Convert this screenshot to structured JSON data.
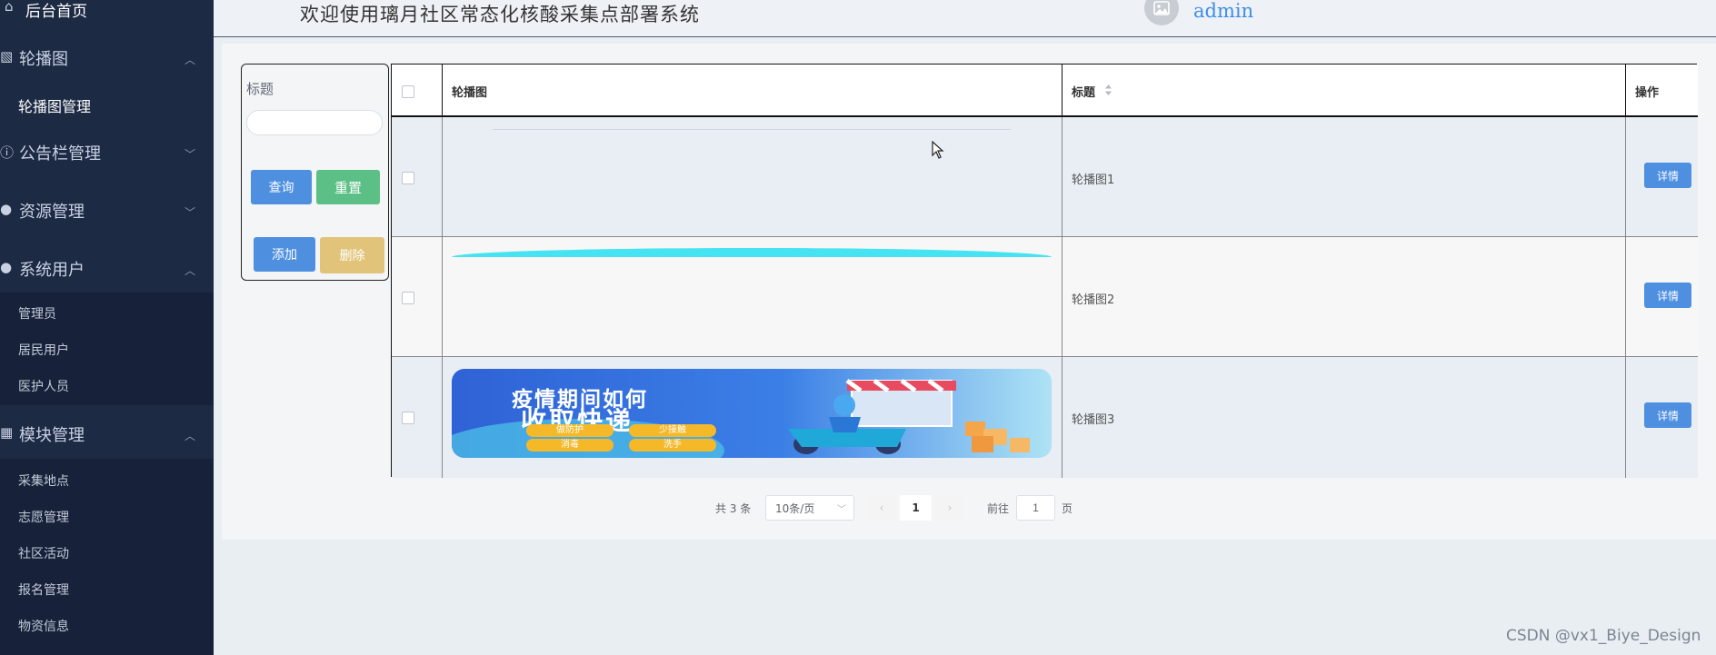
{
  "sidebar": {
    "home": "后台首页",
    "carousel": {
      "label": "轮播图",
      "items": [
        "轮播图管理"
      ]
    },
    "notice": {
      "label": "公告栏管理"
    },
    "resource": {
      "label": "资源管理"
    },
    "system_users": {
      "label": "系统用户",
      "items": [
        "管理员",
        "居民用户",
        "医护人员"
      ]
    },
    "modules": {
      "label": "模块管理",
      "items": [
        "采集地点",
        "志愿管理",
        "社区活动",
        "报名管理",
        "物资信息"
      ]
    }
  },
  "header": {
    "title": "欢迎使用璃月社区常态化核酸采集点部署系统",
    "user": "admin"
  },
  "filter": {
    "label": "标题",
    "input_value": "",
    "query_label": "查询",
    "reset_label": "重置",
    "add_label": "添加",
    "delete_label": "删除"
  },
  "table": {
    "columns": [
      "轮播图",
      "标题",
      "操作"
    ],
    "rows": [
      {
        "title": "轮播图1",
        "action": "详情"
      },
      {
        "title": "轮播图2",
        "action": "详情"
      },
      {
        "title": "轮播图3",
        "action": "详情",
        "banner": {
          "line1": "疫情期间如何",
          "line2": "收取快递",
          "tags": [
            "做防护",
            "少接触",
            "消毒",
            "洗手"
          ]
        }
      }
    ]
  },
  "pagination": {
    "total": "共 3 条",
    "page_size": "10条/页",
    "current_page": "1",
    "goto_label": "前往",
    "goto_value": "1",
    "page_unit": "页"
  },
  "watermark": "CSDN @vx1_Biye_Design",
  "colors": {
    "sidebar_bg": "#1d2a44",
    "primary": "#4e8fe0",
    "success": "#5cbf85",
    "warning": "#e1c47a",
    "user_link": "#3d8ee6"
  }
}
